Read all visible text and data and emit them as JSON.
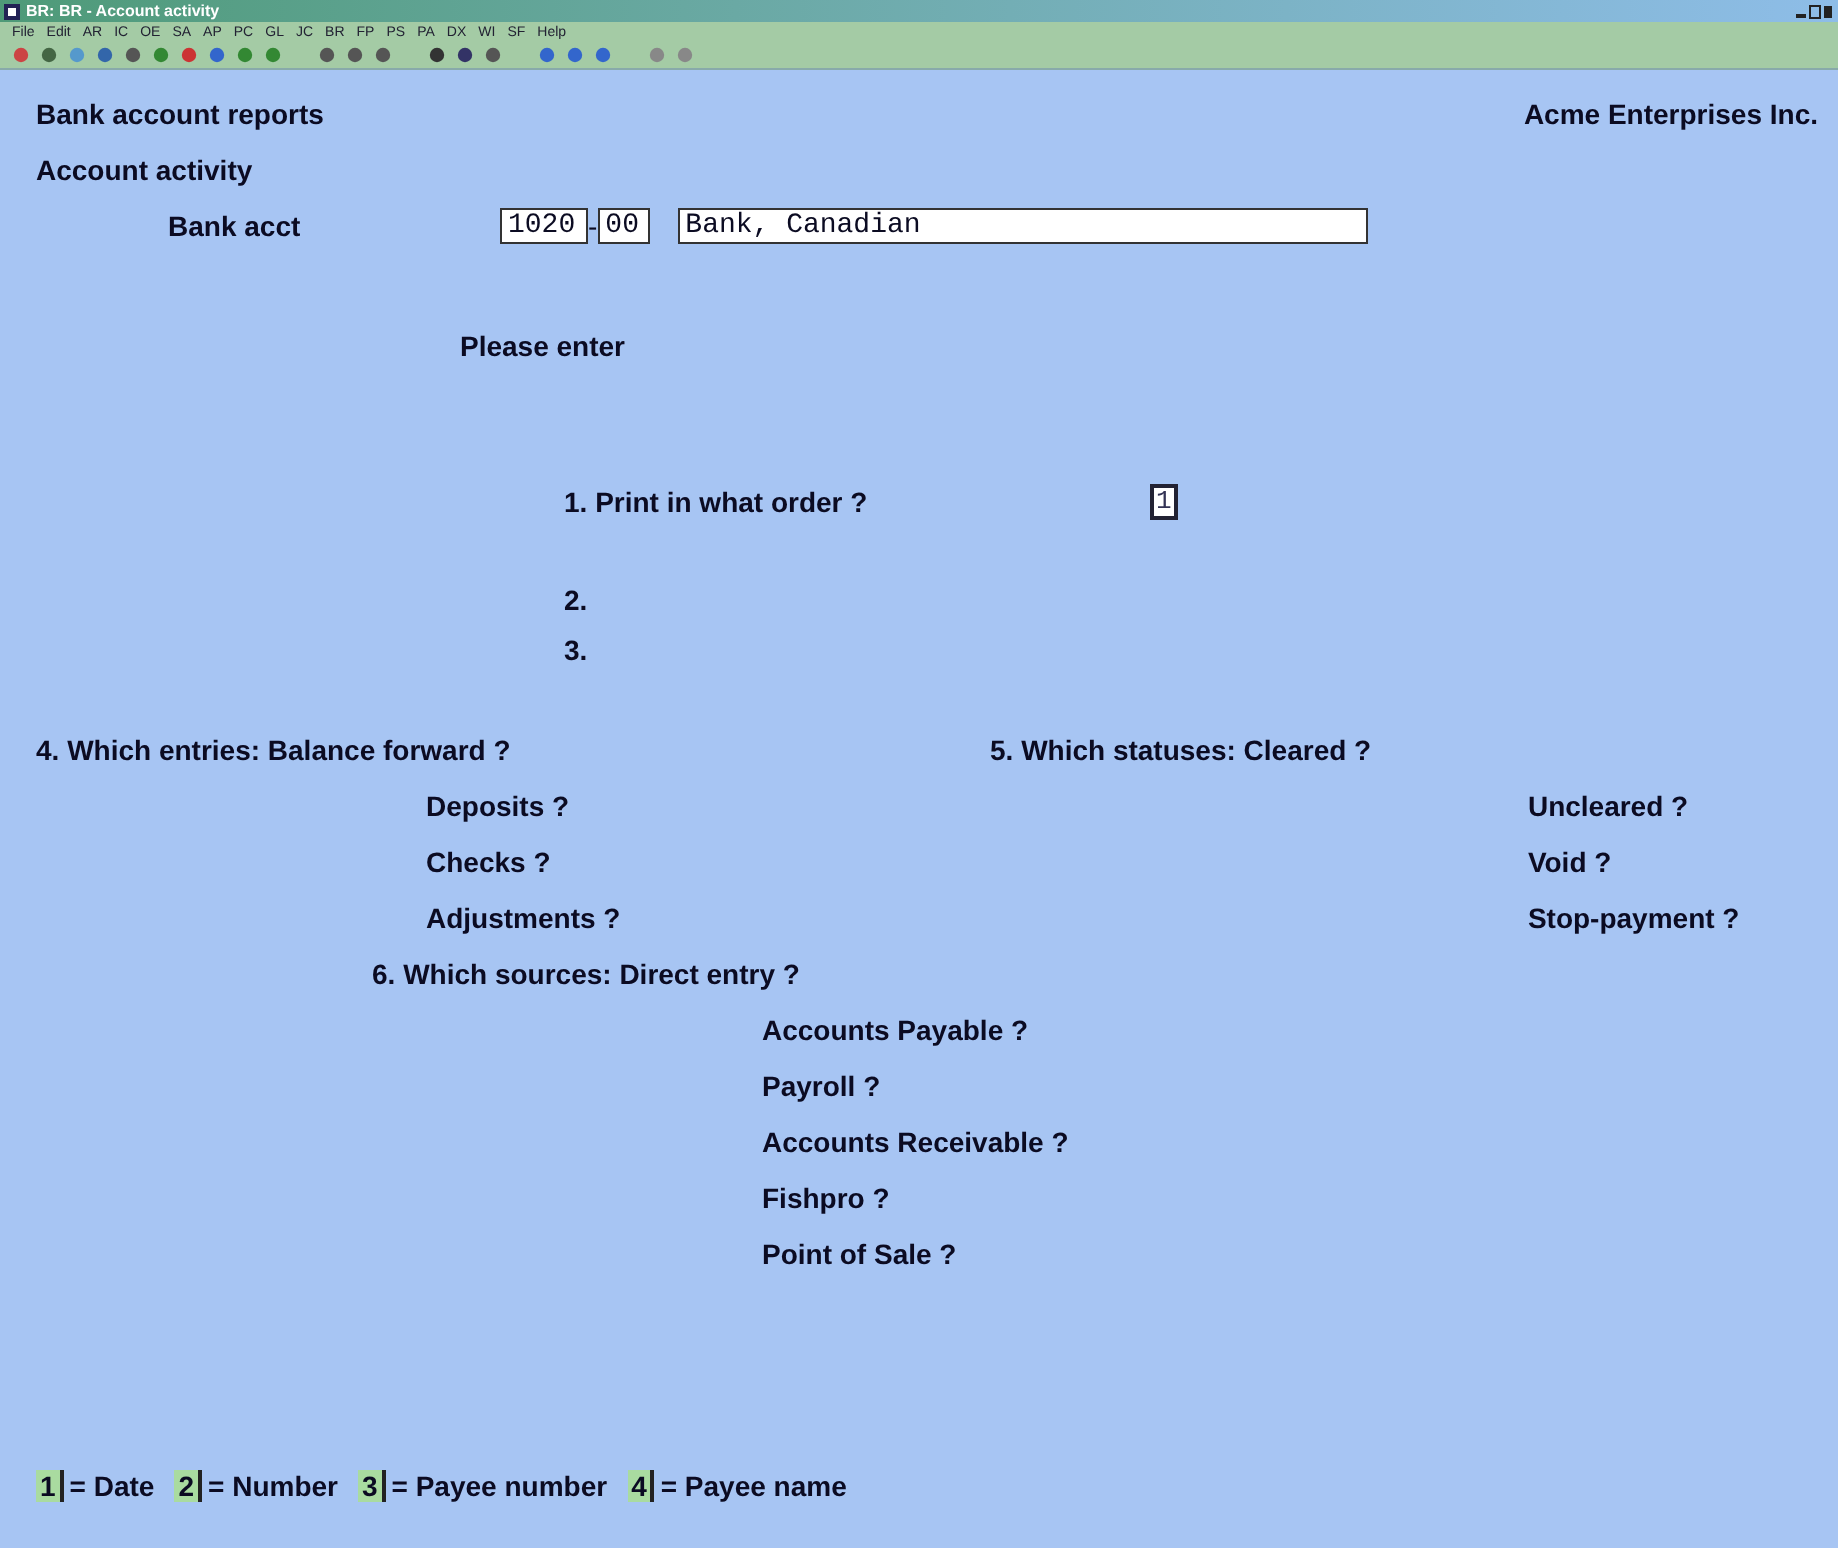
{
  "window": {
    "title": "BR: BR - Account activity"
  },
  "menu": [
    "File",
    "Edit",
    "AR",
    "IC",
    "OE",
    "SA",
    "AP",
    "PC",
    "GL",
    "JC",
    "BR",
    "FP",
    "PS",
    "PA",
    "DX",
    "WI",
    "SF",
    "Help"
  ],
  "header": {
    "title": "Bank account reports",
    "company": "Acme Enterprises Inc.",
    "subtitle": "Account activity"
  },
  "bank_acct": {
    "label": "Bank acct",
    "account": "1020",
    "separator": "-",
    "sub_account": "00",
    "name": "Bank, Canadian"
  },
  "prompt": "Please enter",
  "order": {
    "label": "1. Print in what order ?",
    "value": "1",
    "others": [
      "2.",
      "3."
    ]
  },
  "entries": {
    "label": "4. Which entries: Balance forward ?",
    "items": [
      "Deposits ?",
      "Checks ?",
      "Adjustments ?"
    ]
  },
  "statuses": {
    "label": "5. Which statuses: Cleared ?",
    "items": [
      "Uncleared ?",
      "Void ?",
      "Stop-payment ?"
    ]
  },
  "sources": {
    "label": "6. Which sources: Direct entry ?",
    "items": [
      "Accounts Payable ?",
      "Payroll ?",
      "Accounts Receivable ?",
      "Fishpro ?",
      "Point of Sale ?"
    ]
  },
  "legend": [
    {
      "key": "1",
      "text": "= Date"
    },
    {
      "key": "2",
      "text": "= Number"
    },
    {
      "key": "3",
      "text": "= Payee number"
    },
    {
      "key": "4",
      "text": "= Payee name"
    }
  ]
}
